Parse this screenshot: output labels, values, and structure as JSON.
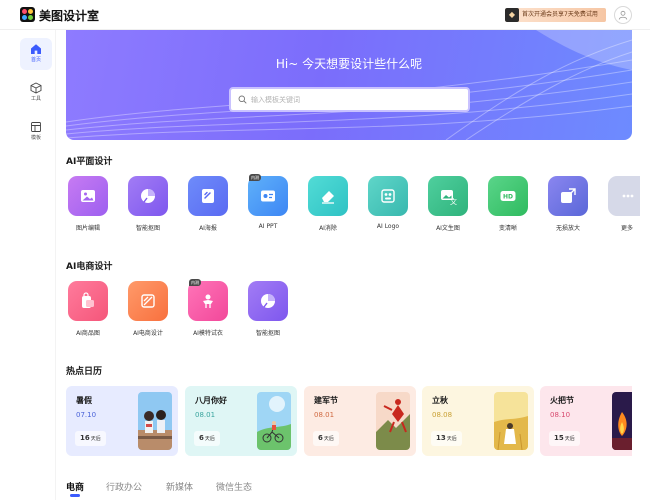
{
  "header": {
    "app_title": "美图设计室",
    "promo": "首次开通会员享7天免费试用"
  },
  "sidebar": {
    "items": [
      {
        "label": "首页",
        "icon": "home-icon",
        "active": true
      },
      {
        "label": "工具",
        "icon": "cube-icon",
        "active": false
      },
      {
        "label": "模板",
        "icon": "template-icon",
        "active": false
      }
    ]
  },
  "banner": {
    "title": "Hi~ 今天想要设计些什么呢",
    "search_placeholder": "输入模板关键词"
  },
  "sections": {
    "ai_graphic": {
      "title": "AI平面设计",
      "tools": [
        {
          "label": "图片编辑",
          "color": "#b46cf0",
          "icon": "image-icon"
        },
        {
          "label": "智能抠图",
          "color": "#9b6cf2",
          "icon": "cutout-icon"
        },
        {
          "label": "AI海报",
          "color": "#6a7cf8",
          "icon": "poster-icon"
        },
        {
          "label": "AI PPT",
          "color": "#4f9cf7",
          "icon": "ppt-icon",
          "tag": "内测"
        },
        {
          "label": "AI消除",
          "color": "#3fd0cf",
          "icon": "eraser-icon"
        },
        {
          "label": "AI Logo",
          "color": "#45c8bd",
          "icon": "logo-icon"
        },
        {
          "label": "AI文生图",
          "color": "#35c08a",
          "icon": "text-to-image-icon"
        },
        {
          "label": "变清晰",
          "color": "#3ac66e",
          "icon": "hd-icon"
        },
        {
          "label": "无损放大",
          "color": "#6b74f0",
          "icon": "enlarge-icon"
        },
        {
          "label": "更多",
          "color": "#c9cce0",
          "icon": "more-icon"
        }
      ]
    },
    "ai_ecommerce": {
      "title": "AI电商设计",
      "tools": [
        {
          "label": "AI商品图",
          "color": "#ff6b8f",
          "icon": "product-image-icon"
        },
        {
          "label": "AI电商设计",
          "color": "#ff8757",
          "icon": "ecommerce-design-icon"
        },
        {
          "label": "AI模特试衣",
          "color": "#ff5fa8",
          "icon": "model-icon",
          "tag": "内测"
        },
        {
          "label": "智能抠图",
          "color": "#9b6cf2",
          "icon": "cutout-icon"
        }
      ]
    },
    "calendar": {
      "title": "热点日历",
      "items": [
        {
          "name": "暑假",
          "date": "07.10",
          "days": "16",
          "days_unit": "天后",
          "bg": "#e7ebff",
          "date_color": "#4a62d8"
        },
        {
          "name": "八月你好",
          "date": "08.01",
          "days": "6",
          "days_unit": "天后",
          "bg": "#dff6f5",
          "date_color": "#3aa59e"
        },
        {
          "name": "建军节",
          "date": "08.01",
          "days": "6",
          "days_unit": "天后",
          "bg": "#fdebe3",
          "date_color": "#d06a42"
        },
        {
          "name": "立秋",
          "date": "08.08",
          "days": "13",
          "days_unit": "天后",
          "bg": "#fdf6e0",
          "date_color": "#c9a033"
        },
        {
          "name": "火把节",
          "date": "08.10",
          "days": "15",
          "days_unit": "天后",
          "bg": "#fde6ec",
          "date_color": "#d84a6f"
        }
      ]
    }
  },
  "template_tabs": [
    {
      "label": "电商",
      "active": true
    },
    {
      "label": "行政办公",
      "active": false
    },
    {
      "label": "新媒体",
      "active": false
    },
    {
      "label": "微信生态",
      "active": false
    }
  ]
}
